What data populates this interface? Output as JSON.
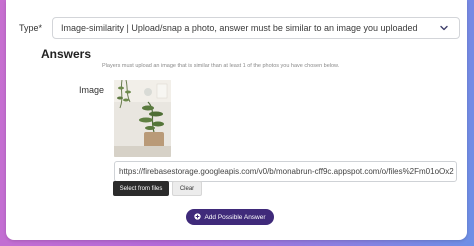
{
  "type_field": {
    "label": "Type*",
    "value": "Image-similarity | Upload/snap a photo, answer must be similar to an image you uploaded",
    "chevron_icon": "chevron-down-icon"
  },
  "answers": {
    "title": "Answers",
    "helper_text": "Players must upload an image that is similar than at least 1 of the photos you have chosen below.",
    "image_label": "Image",
    "image_url": "https://firebasestorage.googleapis.com/v0/b/monabrun-cff9c.appspot.com/o/files%2Fm01oOx2",
    "select_files_label": "Select from files",
    "clear_label": "Clear",
    "add_answer_label": "Add Possible Answer",
    "add_icon": "plus-circle-icon"
  },
  "colors": {
    "accent": "#3f2a7a",
    "dark_button": "#2b2b2b"
  }
}
